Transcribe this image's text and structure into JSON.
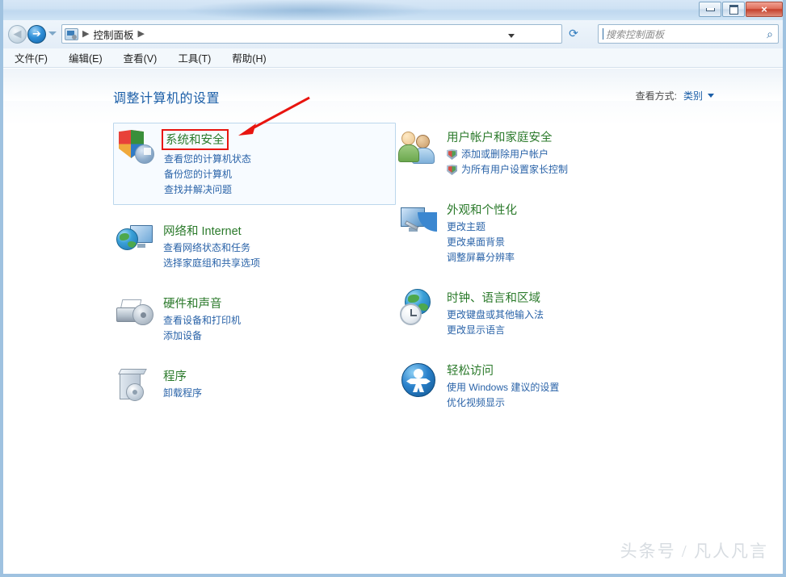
{
  "window": {
    "controls": {
      "minimize_label": "最小化",
      "maximize_label": "最大化",
      "close_label": "×"
    }
  },
  "navbar": {
    "back_label": "◀",
    "forward_label": "➔",
    "breadcrumb_root": "控制面板",
    "separator": "▶",
    "refresh_label": "⟳",
    "search_placeholder": "搜索控制面板",
    "search_value": "",
    "search_icon_glyph": "⌕"
  },
  "menubar": {
    "items": [
      {
        "label": "文件(F)"
      },
      {
        "label": "编辑(E)"
      },
      {
        "label": "查看(V)"
      },
      {
        "label": "工具(T)"
      },
      {
        "label": "帮助(H)"
      }
    ]
  },
  "main": {
    "page_title": "调整计算机的设置",
    "view_by": {
      "label": "查看方式:",
      "value": "类别"
    },
    "categories_left": [
      {
        "title": "系统和安全",
        "selected": true,
        "links": [
          {
            "label": "查看您的计算机状态",
            "shield": false
          },
          {
            "label": "备份您的计算机",
            "shield": false
          },
          {
            "label": "查找并解决问题",
            "shield": false
          }
        ]
      },
      {
        "title": "网络和 Internet",
        "selected": false,
        "links": [
          {
            "label": "查看网络状态和任务",
            "shield": false
          },
          {
            "label": "选择家庭组和共享选项",
            "shield": false
          }
        ]
      },
      {
        "title": "硬件和声音",
        "selected": false,
        "links": [
          {
            "label": "查看设备和打印机",
            "shield": false
          },
          {
            "label": "添加设备",
            "shield": false
          }
        ]
      },
      {
        "title": "程序",
        "selected": false,
        "links": [
          {
            "label": "卸载程序",
            "shield": false
          }
        ]
      }
    ],
    "categories_right": [
      {
        "title": "用户帐户和家庭安全",
        "selected": false,
        "links": [
          {
            "label": "添加或删除用户帐户",
            "shield": true
          },
          {
            "label": "为所有用户设置家长控制",
            "shield": true
          }
        ]
      },
      {
        "title": "外观和个性化",
        "selected": false,
        "links": [
          {
            "label": "更改主题",
            "shield": false
          },
          {
            "label": "更改桌面背景",
            "shield": false
          },
          {
            "label": "调整屏幕分辨率",
            "shield": false
          }
        ]
      },
      {
        "title": "时钟、语言和区域",
        "selected": false,
        "links": [
          {
            "label": "更改键盘或其他输入法",
            "shield": false
          },
          {
            "label": "更改显示语言",
            "shield": false
          }
        ]
      },
      {
        "title": "轻松访问",
        "selected": false,
        "links": [
          {
            "label": "使用 Windows 建议的设置",
            "shield": false
          },
          {
            "label": "优化视频显示",
            "shield": false
          }
        ]
      }
    ]
  },
  "annotation": {
    "arrow_color": "#e8140f",
    "highlight_color": "#e8140f",
    "highlight_target": "系统和安全"
  },
  "watermark": {
    "text": "头条号 / 凡人凡言"
  },
  "colors": {
    "category_title": "#2b7a2b",
    "link": "#2a63a8",
    "page_title": "#1c5fa8",
    "selection_border": "#bcd7ec",
    "selection_background": "#f7fbff"
  }
}
